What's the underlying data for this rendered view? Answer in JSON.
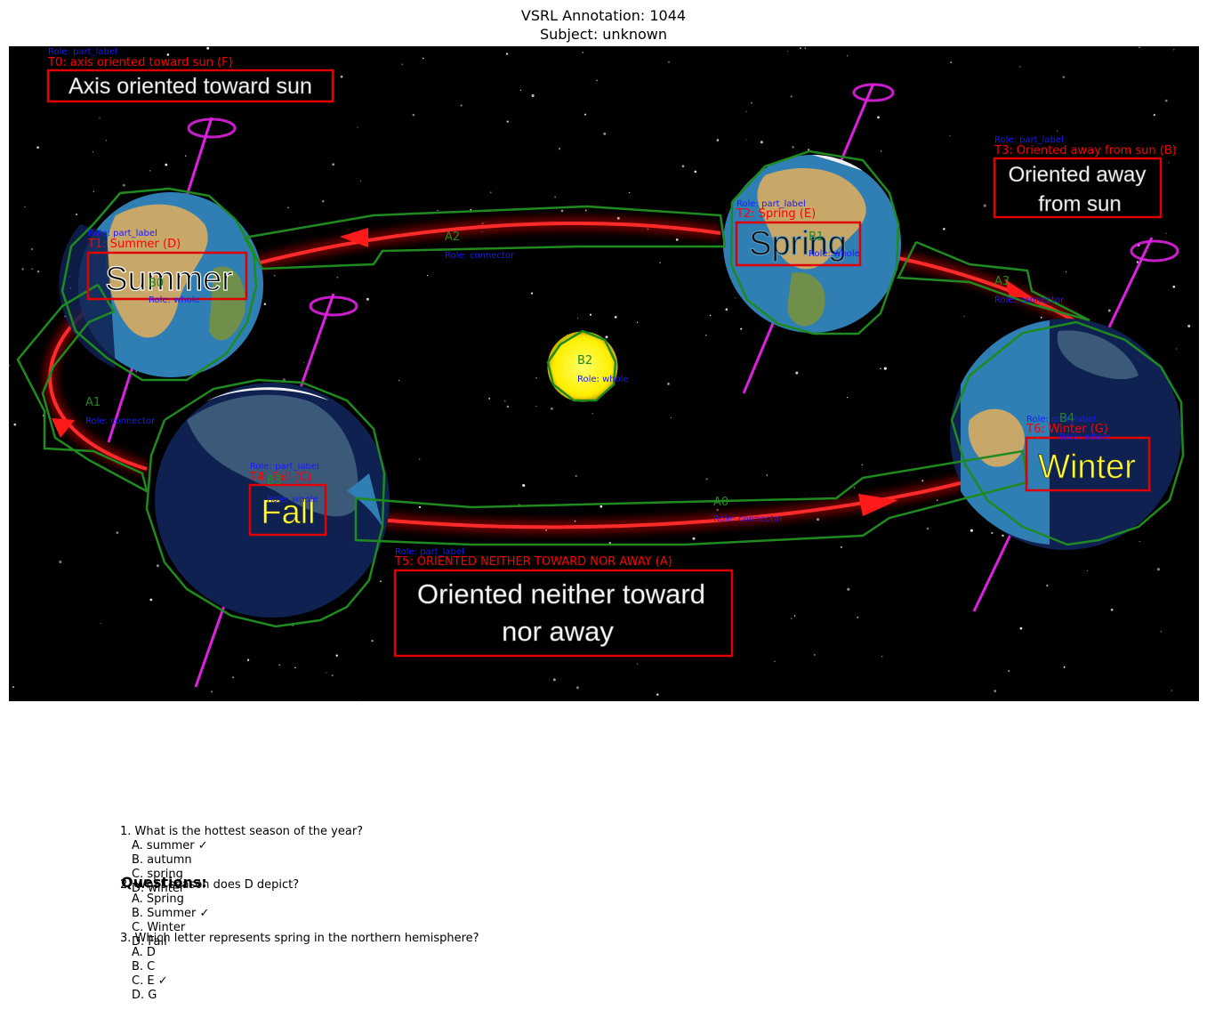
{
  "header": {
    "title": "VSRL Annotation: 1044",
    "subtitle": "Subject: unknown"
  },
  "diagram": {
    "image_labels": {
      "axis_sun": "Axis oriented toward sun",
      "away_line1": "Oriented away",
      "away_line2": "from sun",
      "neither_line1": "Oriented neither toward",
      "neither_line2": "nor away",
      "summer": "Summer",
      "spring": "Spring",
      "fall": "Fall",
      "winter": "Winter"
    },
    "text_boxes": [
      {
        "id": "T0",
        "label": "T0: axis oriented toward sun (F)",
        "role": "Role: part_label"
      },
      {
        "id": "T1",
        "label": "T1: Summer (D)",
        "role": "Role: part_label"
      },
      {
        "id": "T2",
        "label": "T2: Spring (E)",
        "role": "Role: part_label"
      },
      {
        "id": "T3",
        "label": "T3: Oriented away from sun (B)",
        "role": "Role: part_label"
      },
      {
        "id": "T4",
        "label": "T4: Fall (C)",
        "role": "Role: part_label"
      },
      {
        "id": "T5",
        "label": "T5: ORIENTED NEITHER TOWARD NOR AWAY (A)",
        "role": "Role: part_label"
      },
      {
        "id": "T6",
        "label": "T6: Winter (G)",
        "role": "Role: part_label"
      }
    ],
    "blobs": [
      {
        "id": "B0",
        "role": "Role: whole"
      },
      {
        "id": "B1",
        "role": "Role: whole"
      },
      {
        "id": "B2",
        "role": "Role: whole"
      },
      {
        "id": "B3",
        "role": "Role: whole"
      },
      {
        "id": "B4",
        "role": "Role: whole"
      }
    ],
    "arrows": [
      {
        "id": "A0",
        "role": "Role: connector"
      },
      {
        "id": "A1",
        "role": "Role: connector"
      },
      {
        "id": "A2",
        "role": "Role: connector"
      },
      {
        "id": "A3",
        "role": "Role: connector"
      }
    ],
    "colors": {
      "background": "#000000",
      "orbit": "#ff1a1a",
      "axis": "#e020e0",
      "sun": "#ffff00",
      "ocean": "#2f7fb5",
      "land": "#c8a868",
      "night": "#0f2150",
      "text_box": "#e00000",
      "blob_outline": "#1f8a1f",
      "role_text": "#1a1aff"
    }
  },
  "questions": {
    "heading": "Questions:",
    "items": [
      {
        "q": "1. What is the hottest season of the year?",
        "options": [
          "A. summer ✓",
          "B. autumn",
          "C. spring",
          "D. winter"
        ]
      },
      {
        "q": "2. What season does D depict?",
        "options": [
          "A. Spring",
          "B. Summer ✓",
          "C. Winter",
          "D. Fall"
        ]
      },
      {
        "q": "3. Which letter represents spring in the northern hemisphere?",
        "options": [
          "A. D",
          "B. C",
          "C. E ✓",
          "D. G"
        ]
      }
    ]
  }
}
